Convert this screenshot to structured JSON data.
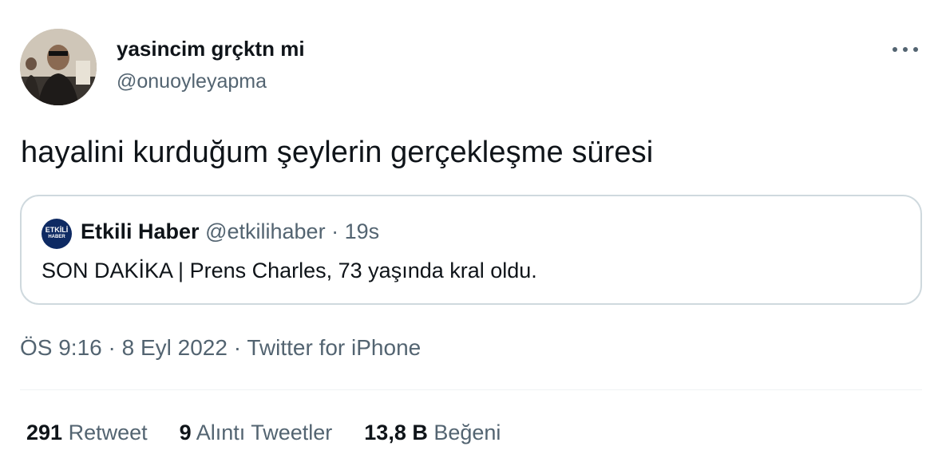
{
  "author": {
    "name": "yasincim grçktn mi",
    "handle": "@onuoyleyapma"
  },
  "tweet": {
    "text": "hayalini kurduğum şeylerin gerçekleşme süresi"
  },
  "quoted": {
    "avatar_line1": "ETKİLİ",
    "avatar_line2": "HABER",
    "name": "Etkili Haber",
    "handle": "@etkilihaber",
    "separator": "·",
    "time": "19s",
    "text": "SON DAKİKA | Prens Charles, 73 yaşında kral oldu."
  },
  "meta": {
    "time": "ÖS 9:16",
    "sep1": "·",
    "date": "8 Eyl 2022",
    "sep2": "·",
    "source": "Twitter for iPhone"
  },
  "stats": [
    {
      "count": "291",
      "label": "Retweet"
    },
    {
      "count": "9",
      "label": "Alıntı Tweetler"
    },
    {
      "count": "13,8 B",
      "label": "Beğeni"
    }
  ],
  "colors": {
    "text": "#0f1419",
    "secondary": "#536471",
    "border": "#cfd9de",
    "divider": "#eff3f4",
    "quoted_avatar": "#0e2a63"
  },
  "icons": {
    "more": "more-horizontal-icon"
  }
}
